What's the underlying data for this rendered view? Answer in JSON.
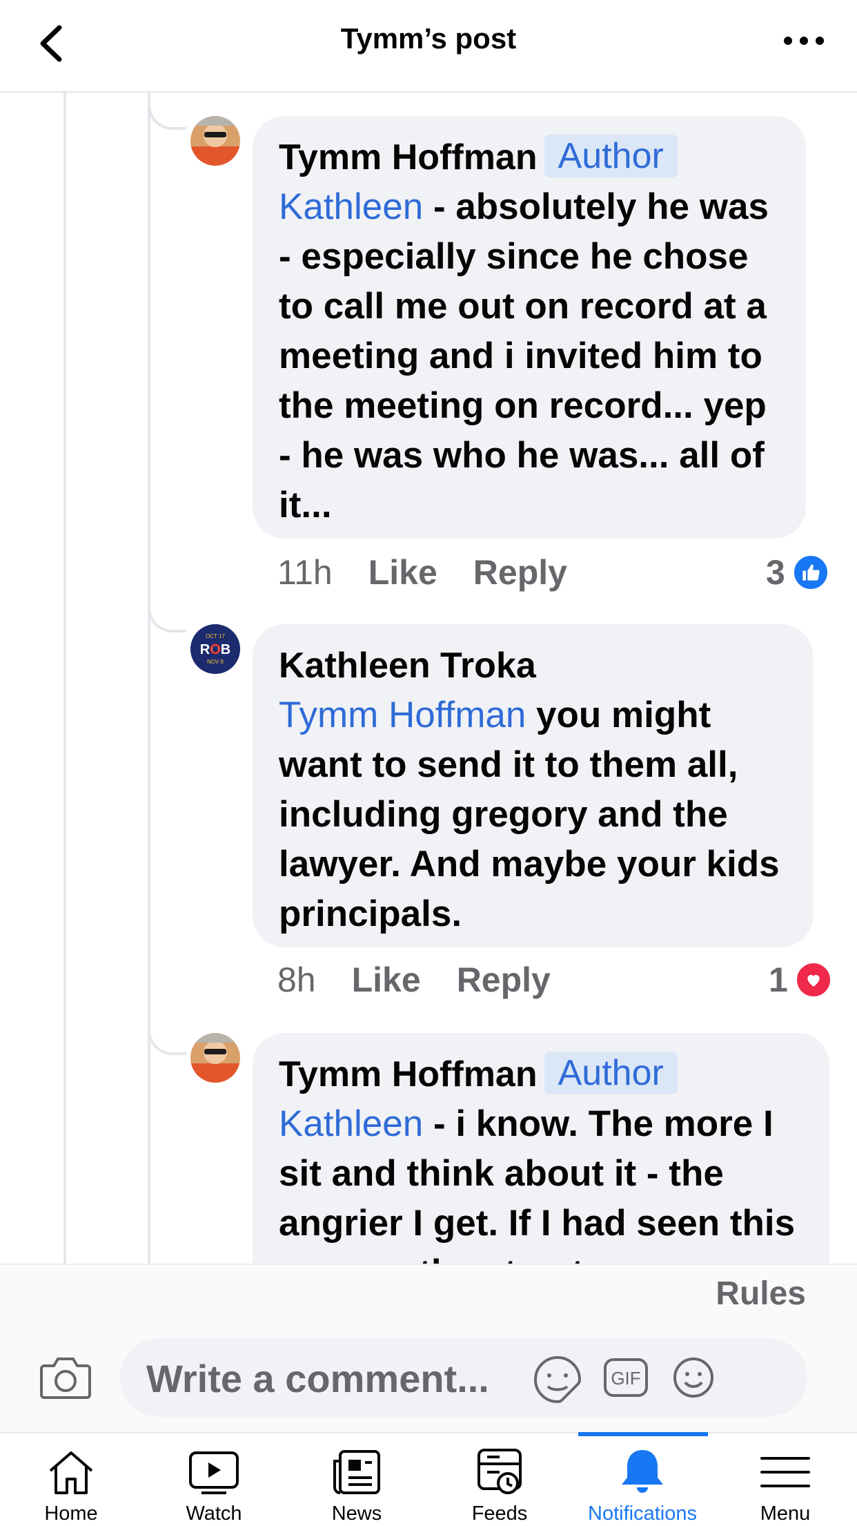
{
  "header": {
    "title": "Tymm’s post",
    "back_icon": "back-chevron-icon",
    "more_icon": "more-horizontal-icon"
  },
  "comments": [
    {
      "author": "Tymm Hoffman",
      "badge": "Author",
      "mention": "Kathleen",
      "text": " - absolutely he was - especially since he chose to call me out on record at a meeting and i invited him to the meeting on record... yep - he was who he was... all of it...",
      "time": "11h",
      "like": "Like",
      "reply": "Reply",
      "reaction_count": "3",
      "reaction_icon": "thumbs-up-icon",
      "reaction_color": "#1877f2"
    },
    {
      "author": "Kathleen Troka",
      "mention": "Tymm Hoffman",
      "text": " you might want to send it to them all, including gregory and the lawyer.  And maybe your kids principals.",
      "time": "8h",
      "like": "Like",
      "reply": "Reply",
      "reaction_count": "1",
      "reaction_icon": "heart-icon",
      "reaction_color": "#f02849"
    },
    {
      "author": "Tymm Hoffman",
      "badge": "Author",
      "mention": "Kathleen",
      "text": " - i know.  The more I sit and think about it - the angrier I get.  If I had seen this man on the street"
    }
  ],
  "avatar2": {
    "top": "OCT 17",
    "middle": "ROB",
    "bottom": "NOV 8"
  },
  "rules": "Rules",
  "composer": {
    "placeholder": "Write a comment...",
    "gif": "GIF"
  },
  "nav": {
    "items": [
      {
        "label": "Home",
        "icon": "home-icon"
      },
      {
        "label": "Watch",
        "icon": "watch-icon"
      },
      {
        "label": "News",
        "icon": "news-icon"
      },
      {
        "label": "Feeds",
        "icon": "feeds-icon"
      },
      {
        "label": "Notifications",
        "icon": "bell-icon",
        "active": true
      },
      {
        "label": "Menu",
        "icon": "menu-icon"
      }
    ],
    "accent": "#1877f2"
  }
}
